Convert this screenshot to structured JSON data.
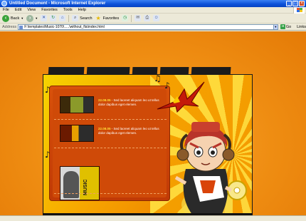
{
  "window": {
    "title": "Untitled Document - Microsoft Internet Explorer"
  },
  "menu": [
    "File",
    "Edit",
    "View",
    "Favorites",
    "Tools",
    "Help"
  ],
  "toolbar": {
    "back_label": "Back",
    "search_label": "Search",
    "favorites_label": "Favorites"
  },
  "address": {
    "label": "Address",
    "url": "F:\\templates\\Music-1070\\.....\\without_fla\\index.html",
    "go_label": "Go",
    "links_label": "Links"
  },
  "site": {
    "news": [
      {
        "date": "22.08.05",
        "text": " - Sed laoreet aliquam leo ut tellus dolor dapibus eget elemen."
      },
      {
        "date": "22.08.05",
        "text": " - Sed laoreet aliquam leo ut tellus dolor dapibus eget elemen."
      }
    ],
    "feature_label": "MUSIC"
  },
  "colors": {
    "page_background": "#ef8d12",
    "panel": "#cf4a08",
    "date_highlight": "#ffdf3a"
  }
}
